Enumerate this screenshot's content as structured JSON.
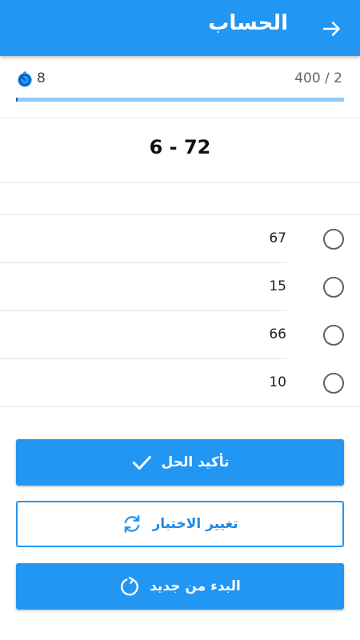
{
  "appbar": {
    "title": "الحساب",
    "back_icon": "arrow-right-icon"
  },
  "status": {
    "timer_icon": "timer-icon",
    "timer_value": "8",
    "progress_text": "400 / 2",
    "progress_fraction": 0.005
  },
  "question": {
    "text": "6 - 72"
  },
  "options": [
    {
      "value": "67"
    },
    {
      "value": "15"
    },
    {
      "value": "66"
    },
    {
      "value": "10"
    }
  ],
  "buttons": {
    "confirm": {
      "label": "تأكيد الحل",
      "icon": "check-icon"
    },
    "change": {
      "label": "تغيير الاختبار",
      "icon": "refresh-icon"
    },
    "restart": {
      "label": "البدء من جديد",
      "icon": "restart-icon"
    }
  },
  "colors": {
    "primary": "#2196f3",
    "track": "#90caf9"
  }
}
